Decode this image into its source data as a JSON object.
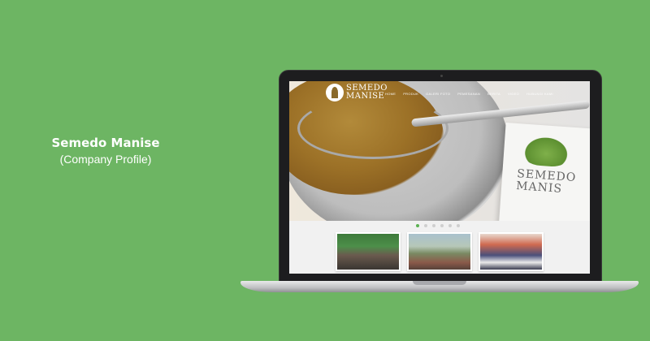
{
  "caption": {
    "title": "Semedo Manise",
    "subtitle": "(Company Profile)"
  },
  "site": {
    "logo_line1": "SEMEDO",
    "logo_line2": "MANISE",
    "nav": [
      "HOME",
      "PRODUK",
      "GALERI FOTO",
      "PEMESANAN",
      "BERITA",
      "VIDEO",
      "HUBUNGI KAMI"
    ],
    "bag_text_line1": "SEMEDO",
    "bag_text_line2": "MANIS"
  },
  "slider": {
    "dot_count": 6,
    "active_dot": 1
  },
  "colors": {
    "background": "#6db563",
    "accent": "#5bb252"
  }
}
